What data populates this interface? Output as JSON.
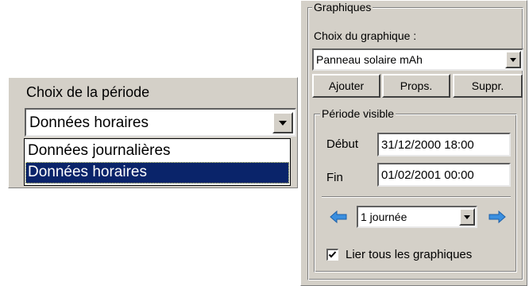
{
  "period": {
    "title": "Choix de la période",
    "selected": "Données horaires",
    "options": [
      "Données journalières",
      "Données horaires"
    ]
  },
  "graphs": {
    "group_title": "Graphiques",
    "choice_label": "Choix du graphique :",
    "selected_graph": "Panneau solaire mAh",
    "buttons": {
      "add": "Ajouter",
      "props": "Props.",
      "delete": "Suppr."
    },
    "visible_period": {
      "title": "Période visible",
      "start_label": "Début",
      "start_value": "31/12/2000 18:00",
      "end_label": "Fin",
      "end_value": "01/02/2001 00:00",
      "step_value": "1 journée",
      "link_label": "Lier tous les graphiques",
      "link_checked": true
    }
  },
  "colors": {
    "face": "#d4d0c8",
    "selection": "#0a246a",
    "arrow": "#3a8fe0"
  }
}
